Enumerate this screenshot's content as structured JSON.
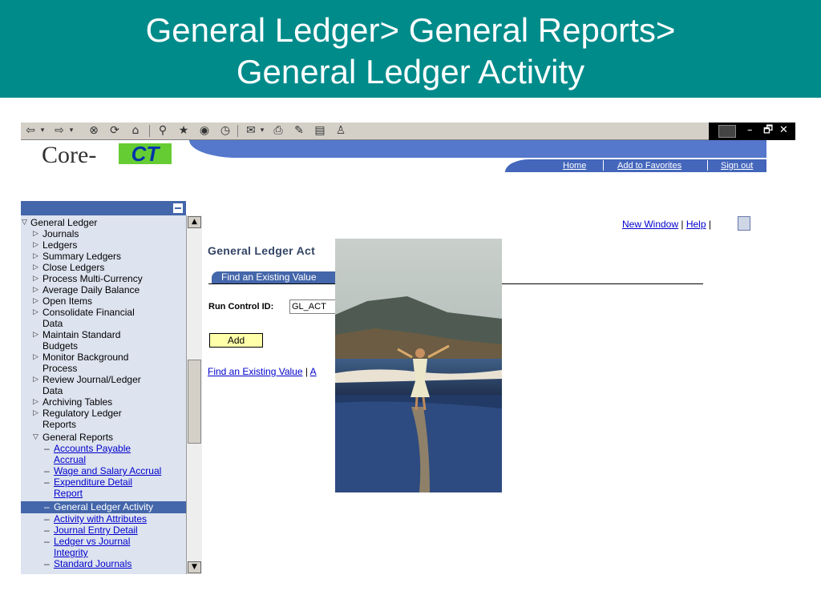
{
  "slide": {
    "title_line1": "General Ledger> General Reports>",
    "title_line2": "General Ledger Activity",
    "header_color": "#008b8b"
  },
  "browser_toolbar": {
    "buttons": [
      "back-icon",
      "forward-icon",
      "stop-icon",
      "refresh-icon",
      "home-icon",
      "search-icon",
      "favorites-icon",
      "history-icon",
      "media-icon",
      "mail-icon",
      "print-icon",
      "edit-icon",
      "discuss-icon",
      "messenger-icon"
    ],
    "window_controls": [
      "–",
      "🗗",
      "✕"
    ]
  },
  "banner": {
    "logo_text": "Core-",
    "logo_ct": "CT",
    "links": [
      "Home",
      "Add to Favorites",
      "Sign out"
    ]
  },
  "nav": {
    "items": [
      {
        "label": "General Ledger",
        "marker": "▽"
      },
      {
        "label": "Journals",
        "marker": "▷"
      },
      {
        "label": "Ledgers",
        "marker": "▷"
      },
      {
        "label": "Summary Ledgers",
        "marker": "▷"
      },
      {
        "label": "Close Ledgers",
        "marker": "▷"
      },
      {
        "label": "Process Multi-Currency",
        "marker": "▷"
      },
      {
        "label": "Average Daily Balance",
        "marker": "▷"
      },
      {
        "label": "Open Items",
        "marker": "▷"
      },
      {
        "label": "Consolidate Financial",
        "label2": "Data",
        "marker": "▷"
      },
      {
        "label": "Maintain Standard",
        "label2": "Budgets",
        "marker": "▷"
      },
      {
        "label": "Monitor Background",
        "label2": "Process",
        "marker": "▷"
      },
      {
        "label": "Review Journal/Ledger",
        "label2": "Data",
        "marker": "▷"
      },
      {
        "label": "Archiving Tables",
        "marker": "▷"
      },
      {
        "label": "Regulatory Ledger",
        "label2": "Reports",
        "marker": "▷"
      },
      {
        "label": "General Reports",
        "marker": "▽"
      },
      {
        "label": "Accounts Payable",
        "label2": "Accrual",
        "marker": "–"
      },
      {
        "label": "Wage and Salary Accrual",
        "marker": "–"
      },
      {
        "label": "Expenditure Detail",
        "label2": "Report",
        "marker": "–"
      },
      {
        "label": "General Ledger Activity",
        "marker": "–"
      },
      {
        "label": "Activity with Attributes",
        "marker": "–"
      },
      {
        "label": "Journal Entry Detail",
        "marker": "–"
      },
      {
        "label": "Ledger vs Journal",
        "label2": "Integrity",
        "marker": "–"
      },
      {
        "label": "Standard Journals",
        "marker": "–"
      }
    ]
  },
  "content": {
    "top_links": [
      "New Window",
      "Help"
    ],
    "page_title": "General Ledger Act",
    "tab_label": "Find an Existing Value",
    "run_control_label": "Run Control ID:",
    "run_control_value": "GL_ACT",
    "add_button": "Add",
    "bottom_link": "Find an Existing Value",
    "bottom_link2": "A"
  }
}
